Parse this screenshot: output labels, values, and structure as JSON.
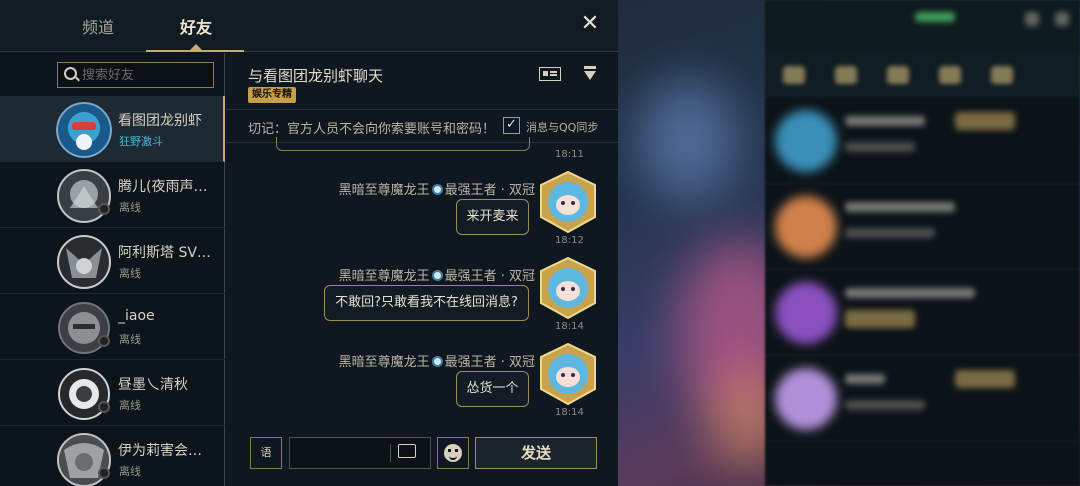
{
  "tabs": {
    "channel": "频道",
    "friends": "好友"
  },
  "search": {
    "placeholder": "搜索好友"
  },
  "friends": [
    {
      "name": "看图团龙别虾",
      "status": "狂野激斗"
    },
    {
      "name": "腾儿(夜雨声…",
      "status": "离线"
    },
    {
      "name": "阿利斯塔 SV…",
      "status": "离线"
    },
    {
      "name": "_iaoe",
      "status": "离线"
    },
    {
      "name": "昼墨乀清秋",
      "status": "离线"
    },
    {
      "name": "伊为莉害会…",
      "status": "离线"
    }
  ],
  "chat": {
    "title": "与看图团龙别虾聊天",
    "tag": "娱乐专精",
    "warning": "切记：官方人员不会向你索要账号和密码！",
    "qq_sync_label": "消息与QQ同步",
    "qq_sync_checked": "✓",
    "first_time": "18:11",
    "messages": [
      {
        "sender": "黑暗至尊魔龙王",
        "rank": "最强王者 · 双冠",
        "text": "来开麦来",
        "time": "18:12"
      },
      {
        "sender": "黑暗至尊魔龙王",
        "rank": "最强王者 · 双冠",
        "text": "不敢回?只敢看我不在线回消息?",
        "time": "18:14"
      },
      {
        "sender": "黑暗至尊魔龙王",
        "rank": "最强王者 · 双冠",
        "text": "怂货一个",
        "time": "18:14"
      }
    ],
    "voice_label": "语",
    "send_label": "发送"
  },
  "close_label": "✕",
  "colors": {
    "gold": "#c8aa6e",
    "cyan": "#4fb7d6",
    "bg": "#0e171f"
  }
}
